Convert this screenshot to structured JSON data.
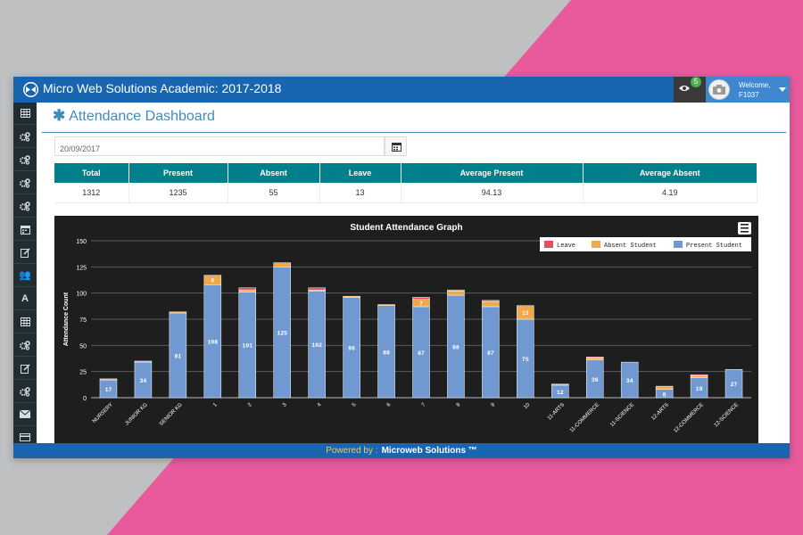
{
  "app": {
    "title": "Micro Web Solutions Academic: 2017-2018",
    "notification_count": "5",
    "welcome_label": "Welcome,",
    "username": "F1037"
  },
  "sidebar": {
    "items": [
      {
        "icon": "table-icon"
      },
      {
        "icon": "cogs-icon"
      },
      {
        "icon": "cogs-icon"
      },
      {
        "icon": "cogs-icon"
      },
      {
        "icon": "cogs-icon"
      },
      {
        "icon": "calendar-icon"
      },
      {
        "icon": "edit-icon"
      },
      {
        "icon": "users-icon",
        "glyph": "👥"
      },
      {
        "icon": "font-icon",
        "glyph": "A"
      },
      {
        "icon": "table-icon"
      },
      {
        "icon": "cogs-icon"
      },
      {
        "icon": "edit-icon"
      },
      {
        "icon": "cogs-icon"
      },
      {
        "icon": "envelope-icon"
      },
      {
        "icon": "credit-card-icon"
      }
    ]
  },
  "page": {
    "title": "Attendance Dashboard",
    "date_value": "20/09/2017"
  },
  "summary": {
    "headers": [
      "Total",
      "Present",
      "Absent",
      "Leave",
      "Average Present",
      "Average Absent"
    ],
    "values": [
      "1312",
      "1235",
      "55",
      "13",
      "94.13",
      "4.19"
    ]
  },
  "chart_data": {
    "type": "bar",
    "stacked": true,
    "title": "Student Attendance Graph",
    "ylabel": "Attendance Count",
    "xlabel": "",
    "ylim": [
      0,
      150
    ],
    "yticks": [
      0,
      25,
      50,
      75,
      100,
      125,
      150
    ],
    "legend_position": "top-right",
    "categories": [
      "NURSERY",
      "JUNIOR KG",
      "SENIOR KG",
      "1",
      "2",
      "3",
      "4",
      "5",
      "6",
      "7",
      "8",
      "9",
      "10",
      "11-ARTS",
      "11-COMMERCE",
      "11-SCIENCE",
      "12-ARTS",
      "12-COMMERCE",
      "12-SCIENCE"
    ],
    "series": [
      {
        "name": "Present Student",
        "color": "#7199d1",
        "values": [
          17,
          34,
          81,
          108,
          101,
          125,
          102,
          96,
          88,
          87,
          98,
          87,
          75,
          12,
          36,
          34,
          8,
          19,
          27
        ]
      },
      {
        "name": "Absent Student",
        "color": "#f0a84a",
        "values": [
          1,
          1,
          1,
          9,
          2,
          4,
          1,
          1,
          1,
          7,
          4,
          5,
          13,
          1,
          2,
          0,
          3,
          2,
          0
        ]
      },
      {
        "name": "Leave",
        "color": "#e4505c",
        "values": [
          0,
          0,
          0,
          0,
          2,
          0,
          2,
          0,
          0,
          2,
          1,
          1,
          0,
          0,
          1,
          0,
          0,
          1,
          0
        ]
      }
    ],
    "data_labels": [
      "17",
      "34",
      "81",
      "108",
      "101",
      "125",
      "102",
      "96",
      "88",
      "87",
      "98",
      "87",
      "75",
      "12",
      "36",
      "34",
      "8",
      "19",
      "27"
    ],
    "absent_labels": [
      "",
      "",
      "",
      "9",
      "",
      "",
      "",
      "",
      "",
      "7",
      "",
      "",
      "13",
      "",
      "",
      "",
      "",
      "",
      ""
    ],
    "legend_order": [
      "Leave",
      "Absent Student",
      "Present Student"
    ]
  },
  "footer": {
    "powered_by": "Powered by :",
    "brand": "Microweb Solutions ™"
  },
  "colors": {
    "header_blue": "#1a65b0",
    "teal": "#00808a",
    "accent": "#3c8dbc",
    "pink": "#e85a9c"
  }
}
